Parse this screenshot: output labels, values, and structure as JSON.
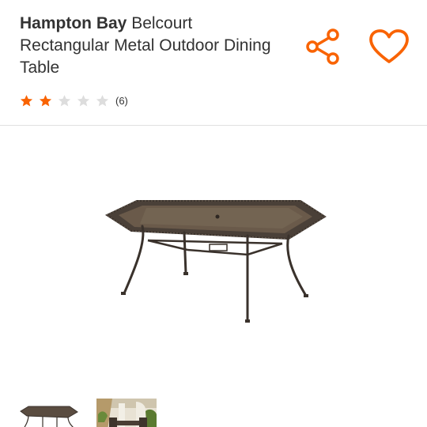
{
  "product": {
    "brand": "Hampton Bay",
    "name": " Belcourt Rectangular Metal Outdoor Dining Table"
  },
  "rating": {
    "stars": 2,
    "max_stars": 5,
    "review_count": "(6)"
  },
  "actions": {
    "share_icon": "share-icon",
    "favorite_icon": "heart-icon"
  },
  "gallery": {
    "selected_index": 0,
    "thumbnail_count": 2
  },
  "colors": {
    "accent": "#f96302",
    "star_filled": "#f96302",
    "star_empty": "#dddddd",
    "text": "#333333",
    "divider": "#e0e0e0"
  }
}
